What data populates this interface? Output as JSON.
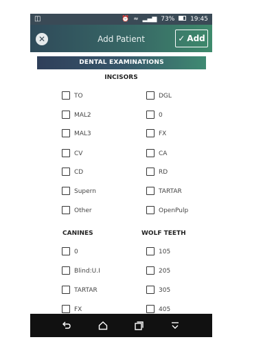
{
  "status_bar": {
    "left_icon": "notification-icon",
    "battery": "73%",
    "time": "19:45"
  },
  "app_bar": {
    "title": "Add Patient",
    "add_label": "Add"
  },
  "banner": "DENTAL EXAMINATIONS",
  "incisors": {
    "title": "INCISORS",
    "left": [
      "TO",
      "MAL2",
      "MAL3",
      "CV",
      "CD",
      "Supern",
      "Other"
    ],
    "right": [
      "DGL",
      "0",
      "FX",
      "CA",
      "RD",
      "TARTAR",
      "OpenPulp"
    ]
  },
  "canines": {
    "title": "CANINES",
    "items": [
      "0",
      "Blind:U.I",
      "TARTAR",
      "FX"
    ]
  },
  "wolf_teeth": {
    "title": "WOLF TEETH",
    "items": [
      "105",
      "205",
      "305",
      "405"
    ]
  },
  "nav_bar": {
    "icons": [
      "back-icon",
      "home-icon",
      "recents-icon",
      "menu-icon"
    ]
  }
}
